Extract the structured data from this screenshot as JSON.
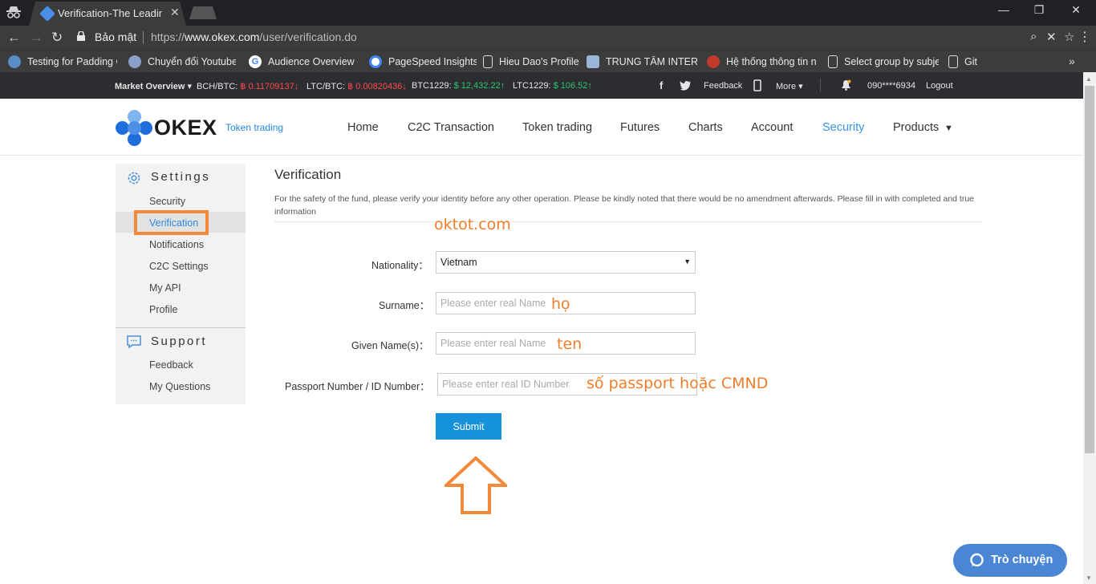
{
  "browser": {
    "tab_title": "Verification-The Leading",
    "security_label": "Bảo mật",
    "url_scheme": "https://",
    "url_host": "www.okex.com",
    "url_path": "/user/verification.do",
    "bookmarks": [
      {
        "label": "Testing for Padding C",
        "icon": "globe-icon",
        "color": "#5a8dc8"
      },
      {
        "label": "Chuyển đổi Youtube",
        "icon": "swirl-icon",
        "color": "#8aa0c8"
      },
      {
        "label": "Audience Overview -",
        "icon": "google-icon",
        "color": "#ffffff"
      },
      {
        "label": "PageSpeed Insights",
        "icon": "pagespeed-icon",
        "color": "#ffffff"
      },
      {
        "label": "Hieu Dao's Profile",
        "icon": "page-icon",
        "color": "#3c3c3c"
      },
      {
        "label": "TRUNG TÂM INTERN",
        "icon": "image-icon",
        "color": "#9bb5d8"
      },
      {
        "label": "Hệ thống thông tin n",
        "icon": "oracle-icon",
        "color": "#c0392b"
      },
      {
        "label": "Select group by subje",
        "icon": "page-icon",
        "color": "#3c3c3c"
      },
      {
        "label": "Git",
        "icon": "page-icon",
        "color": "#3c3c3c"
      }
    ]
  },
  "ticker": {
    "market_overview": "Market Overview ▾",
    "items": [
      {
        "pair": "BCH/BTC:",
        "value": "฿ 0.11709137↓",
        "color": "#ff4949"
      },
      {
        "pair": "LTC/BTC:",
        "value": "฿ 0.00820436↓",
        "color": "#ff4949"
      },
      {
        "pair": "BTC1229:",
        "value": "$ 12,432.22↑",
        "color": "#2ec56f"
      },
      {
        "pair": "LTC1229:",
        "value": "$ 106.52↑",
        "color": "#2ec56f"
      }
    ],
    "feedback": "Feedback",
    "more": "More ▾",
    "phone": "090****6934",
    "logout": "Logout"
  },
  "header": {
    "brand": "OKEX",
    "brand_sub": "Token trading",
    "nav": [
      {
        "label": "Home",
        "active": false
      },
      {
        "label": "C2C Transaction",
        "active": false
      },
      {
        "label": "Token trading",
        "active": false
      },
      {
        "label": "Futures",
        "active": false
      },
      {
        "label": "Charts",
        "active": false
      },
      {
        "label": "Account",
        "active": false
      },
      {
        "label": "Security",
        "active": true
      },
      {
        "label": "Products",
        "active": false
      }
    ],
    "accent_color": "#3895e8"
  },
  "sidebar": {
    "settings_title": "Settings",
    "settings_items": [
      "Security",
      "Verification",
      "Notifications",
      "C2C Settings",
      "My API",
      "Profile"
    ],
    "active_item": "Verification",
    "support_title": "Support",
    "support_items": [
      "Feedback",
      "My Questions"
    ]
  },
  "main": {
    "title": "Verification",
    "description": "For the safety of the fund, please verify your identity before any other operation. Please be kindly noted that there would be no amendment afterwards. Please fill in with completed and true information",
    "form": {
      "nationality_label": "Nationality：",
      "nationality_value": "Vietnam",
      "surname_label": "Surname：",
      "surname_placeholder": "Please enter real Name",
      "given_label": "Given Name(s)：",
      "given_placeholder": "Please enter real Name",
      "passport_label": "Passport Number / ID Number：",
      "passport_placeholder": "Please enter real ID Number",
      "submit_label": "Submit"
    }
  },
  "annotations": {
    "site": "oktot.com",
    "surname_note": "họ",
    "given_note": "ten",
    "passport_note": "số passport hoặc CMND",
    "color": "#f07d2a"
  },
  "chat": {
    "label": "Trò chuyện"
  }
}
